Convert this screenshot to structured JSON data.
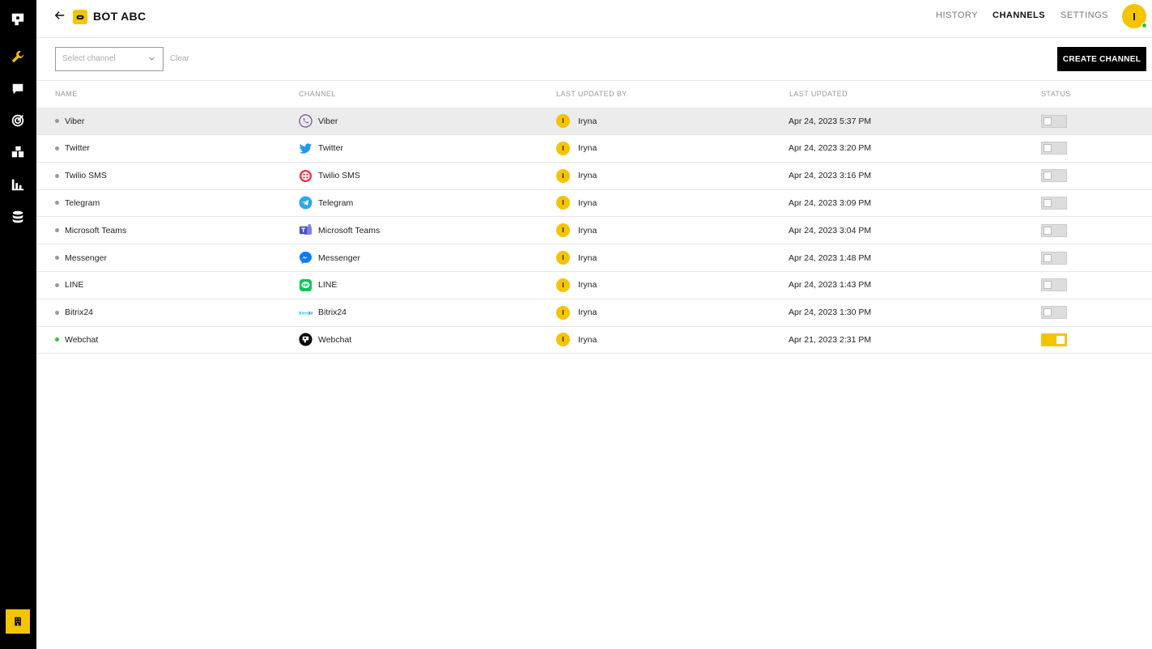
{
  "app": {
    "bot_title": "BOT ABC",
    "accent_color": "#f5c400"
  },
  "sidebar": {
    "items": [
      {
        "icon": "logo-icon"
      },
      {
        "icon": "wrench-icon"
      },
      {
        "icon": "chat-icon"
      },
      {
        "icon": "target-icon"
      },
      {
        "icon": "blocks-icon"
      },
      {
        "icon": "bar-chart-icon"
      },
      {
        "icon": "database-icon"
      }
    ],
    "bottom_icon": "building-icon"
  },
  "nav": {
    "history": "HISTORY",
    "channels": "CHANNELS",
    "settings": "SETTINGS",
    "active": "CHANNELS"
  },
  "user": {
    "initial": "I"
  },
  "toolbar": {
    "select_placeholder": "Select channel",
    "clear_label": "Clear",
    "create_label": "CREATE CHANNEL"
  },
  "table": {
    "headers": {
      "name": "NAME",
      "channel": "CHANNEL",
      "updated_by": "LAST UPDATED BY",
      "updated": "LAST UPDATED",
      "status": "STATUS"
    },
    "rows": [
      {
        "name": "Viber",
        "channel": "Viber",
        "icon": "viber-icon",
        "user_initial": "I",
        "user": "Iryna",
        "updated": "Apr 24, 2023 5:37 PM",
        "active": false
      },
      {
        "name": "Twitter",
        "channel": "Twitter",
        "icon": "twitter-icon",
        "user_initial": "I",
        "user": "Iryna",
        "updated": "Apr 24, 2023 3:20 PM",
        "active": false
      },
      {
        "name": "Twilio SMS",
        "channel": "Twilio SMS",
        "icon": "twilio-icon",
        "user_initial": "I",
        "user": "Iryna",
        "updated": "Apr 24, 2023 3:16 PM",
        "active": false
      },
      {
        "name": "Telegram",
        "channel": "Telegram",
        "icon": "telegram-icon",
        "user_initial": "I",
        "user": "Iryna",
        "updated": "Apr 24, 2023 3:09 PM",
        "active": false
      },
      {
        "name": "Microsoft Teams",
        "channel": "Microsoft Teams",
        "icon": "teams-icon",
        "user_initial": "I",
        "user": "Iryna",
        "updated": "Apr 24, 2023 3:04 PM",
        "active": false
      },
      {
        "name": "Messenger",
        "channel": "Messenger",
        "icon": "messenger-icon",
        "user_initial": "I",
        "user": "Iryna",
        "updated": "Apr 24, 2023 1:48 PM",
        "active": false
      },
      {
        "name": "LINE",
        "channel": "LINE",
        "icon": "line-icon",
        "user_initial": "I",
        "user": "Iryna",
        "updated": "Apr 24, 2023 1:43 PM",
        "active": false
      },
      {
        "name": "Bitrix24",
        "channel": "Bitrix24",
        "icon": "bitrix24-icon",
        "user_initial": "I",
        "user": "Iryna",
        "updated": "Apr 24, 2023 1:30 PM",
        "active": false
      },
      {
        "name": "Webchat",
        "channel": "Webchat",
        "icon": "webchat-icon",
        "user_initial": "I",
        "user": "Iryna",
        "updated": "Apr 21, 2023 2:31 PM",
        "active": true
      }
    ]
  }
}
